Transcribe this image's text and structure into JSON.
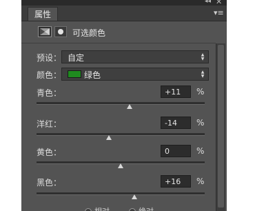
{
  "panel": {
    "collapse_glyph": "◂◂",
    "close_glyph": "✕",
    "tab_label": "属性",
    "menu_glyph": "▾≡",
    "header_title": "可选颜色"
  },
  "icons": {
    "adjustment": "selective-color-adjustment-icon",
    "mask": "layer-mask-icon"
  },
  "preset": {
    "label": "预设：",
    "value": "自定",
    "arrows": "▴▾"
  },
  "colors": {
    "label": "颜色：",
    "value": "绿色",
    "swatch_color": "#1f8a1f",
    "arrows": "▴▾"
  },
  "sliders": [
    {
      "key": "cyan",
      "label": "青色：",
      "value": "+11",
      "unit": "%",
      "level": 11
    },
    {
      "key": "magenta",
      "label": "洋红：",
      "value": "-14",
      "unit": "%",
      "level": -14
    },
    {
      "key": "yellow",
      "label": "黄色：",
      "value": "0",
      "unit": "%",
      "level": 0
    },
    {
      "key": "black",
      "label": "黑色：",
      "value": "+16",
      "unit": "%",
      "level": 16
    }
  ],
  "method": {
    "relative": "相对",
    "absolute": "绝对"
  }
}
